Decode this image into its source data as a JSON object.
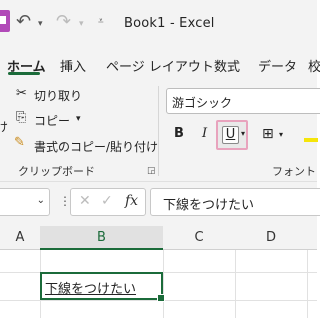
{
  "title_bar": {
    "title": "Book1  -  Excel",
    "undo_icon": "undo-icon",
    "redo_icon": "redo-icon"
  },
  "tabs": [
    {
      "label": "ホーム",
      "active": true
    },
    {
      "label": "挿入"
    },
    {
      "label": "ページ レイアウト"
    },
    {
      "label": "数式"
    },
    {
      "label": "データ"
    },
    {
      "label": "校"
    }
  ],
  "clipboard": {
    "cut": "切り取り",
    "copy": "コピー",
    "format_painter": "書式のコピー/貼り付け",
    "group_label": "クリップボード",
    "paste_fragment": "け"
  },
  "font": {
    "font_name": "游ゴシック",
    "bold": "B",
    "italic": "I",
    "underline": "U",
    "group_label": "フォント"
  },
  "formula_bar": {
    "name_box": "",
    "fx": "fx",
    "formula": "下線をつけたい"
  },
  "grid": {
    "columns": [
      "A",
      "B",
      "C",
      "D"
    ],
    "selected_column": "B",
    "active_cell_text": "下線をつけたい"
  },
  "colors": {
    "accent": "#1b6b3a",
    "highlight": "#e8a3bd",
    "fill": "#f5e50a"
  }
}
